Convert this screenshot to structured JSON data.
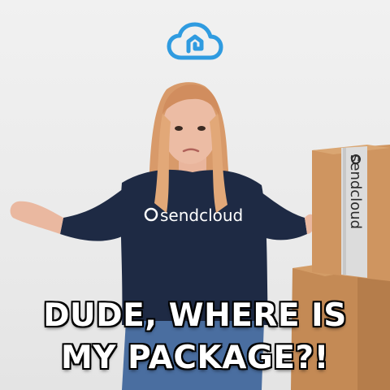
{
  "brand": {
    "logo_icon": "sendcloud-cloud-icon",
    "accent_color": "#2f9be0",
    "sweater_text": "sendcloud",
    "box_tape_text": "sendcloud"
  },
  "caption": {
    "line1": "DUDE, WHERE IS",
    "line2": "MY PACKAGE?!"
  }
}
